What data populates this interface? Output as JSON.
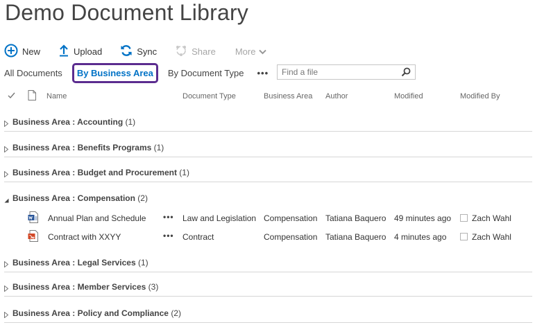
{
  "page": {
    "title": "Demo Document Library"
  },
  "toolbar": {
    "new_label": "New",
    "upload_label": "Upload",
    "sync_label": "Sync",
    "share_label": "Share",
    "more_label": "More"
  },
  "views": {
    "all_documents": "All Documents",
    "by_business_area": "By Business Area",
    "by_document_type": "By Document Type",
    "more": "•••"
  },
  "search": {
    "placeholder": "Find a file"
  },
  "columns": {
    "name": "Name",
    "document_type": "Document Type",
    "business_area": "Business Area",
    "author": "Author",
    "modified": "Modified",
    "modified_by": "Modified By"
  },
  "colors": {
    "accent": "#0072c6",
    "selected_border": "#5b2c8f",
    "word_icon": "#2b579a",
    "pdf_icon": "#d24726"
  },
  "groups": [
    {
      "prefix": "Business Area : ",
      "name": "Accounting",
      "count": "(1)",
      "expanded": false
    },
    {
      "prefix": "Business Area : ",
      "name": "Benefits Programs",
      "count": "(1)",
      "expanded": false
    },
    {
      "prefix": "Business Area : ",
      "name": "Budget and Procurement",
      "count": "(1)",
      "expanded": false
    },
    {
      "prefix": "Business Area : ",
      "name": "Compensation",
      "count": "(2)",
      "expanded": true
    },
    {
      "prefix": "Business Area : ",
      "name": "Legal Services",
      "count": "(1)",
      "expanded": false
    },
    {
      "prefix": "Business Area : ",
      "name": "Member Services",
      "count": "(3)",
      "expanded": false
    },
    {
      "prefix": "Business Area : ",
      "name": "Policy and Compliance",
      "count": "(2)",
      "expanded": false
    }
  ],
  "items": [
    {
      "icon": "word-document-icon",
      "name": "Annual Plan and Schedule",
      "ellipsis": "•••",
      "document_type": "Law and Legislation",
      "business_area": "Compensation",
      "author": "Tatiana Baquero",
      "modified": "49 minutes ago",
      "modified_by": "Zach Wahl"
    },
    {
      "icon": "pdf-document-icon",
      "name": "Contract with XXYY",
      "ellipsis": "•••",
      "document_type": "Contract",
      "business_area": "Compensation",
      "author": "Tatiana Baquero",
      "modified": "4 minutes ago",
      "modified_by": "Zach Wahl"
    }
  ]
}
